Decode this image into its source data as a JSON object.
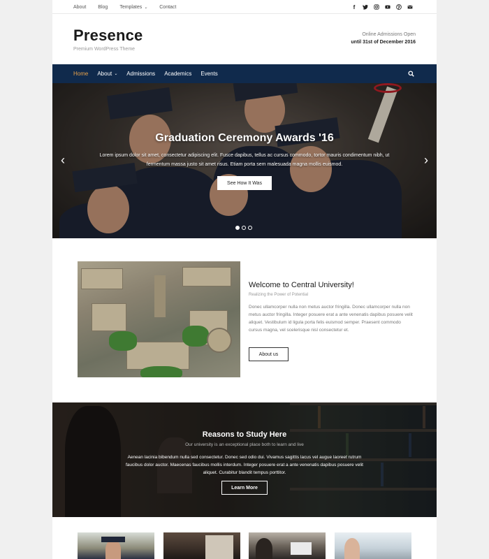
{
  "topbar": {
    "links": [
      "About",
      "Blog",
      "Templates",
      "Contact"
    ],
    "social_icons": [
      "facebook-icon",
      "twitter-icon",
      "instagram-icon",
      "youtube-icon",
      "pinterest-icon",
      "mail-icon"
    ]
  },
  "header": {
    "logo": "Presence",
    "tagline": "Premium WordPress Theme",
    "notice_line1": "Online Admissions Open",
    "notice_line2": "until 31st of December 2016"
  },
  "nav": {
    "items": [
      "Home",
      "About",
      "Admissions",
      "Academics",
      "Events"
    ],
    "active": "Home",
    "search_icon": "search-icon"
  },
  "hero": {
    "title": "Graduation Ceremony Awards '16",
    "text": "Lorem ipsum dolor sit amet, consectetur adipiscing elit. Fusce dapibus, tellus ac cursus commodo, tortor mauris condimentum nibh, ut fermentum massa justo sit amet risus. Etiam porta sem malesuada magna mollis euismod.",
    "button": "See How It Was",
    "prev_icon": "chevron-left-icon",
    "next_icon": "chevron-right-icon",
    "slides_total": 3,
    "slide_active": 1
  },
  "welcome": {
    "title": "Welcome to Central University!",
    "subtitle": "Realizing the Power of Potential",
    "text": "Donec ullamcorper nulla non metus auctor fringilla. Donec ullamcorper nulla non metus auctor fringilla. Integer posuere erat a ante venenatis dapibus posuere velit aliquet. Vestibulum id ligula porta felis euismod semper. Praesent commodo cursus magna, vel scelerisque nisl consectetur et.",
    "button": "About us"
  },
  "reasons": {
    "title": "Reasons to Study Here",
    "subtitle": "Our university is an exceptional place both to learn and live",
    "text": "Aenean lacinia bibendum nulla sed consectetur. Donec sed odio dui. Vivamus sagittis lacus vel augue laoreet rutrum faucibus dolor auctor. Maecenas faucibus mollis interdum. Integer posuere erat a ante venenatis dapibus posuere velit aliquet. Curabitur blandit tempus porttitor.",
    "button": "Learn More"
  },
  "colors": {
    "nav_bg": "#102a4c",
    "nav_active": "#e7a24b",
    "page_bg": "#f0f0f0"
  }
}
